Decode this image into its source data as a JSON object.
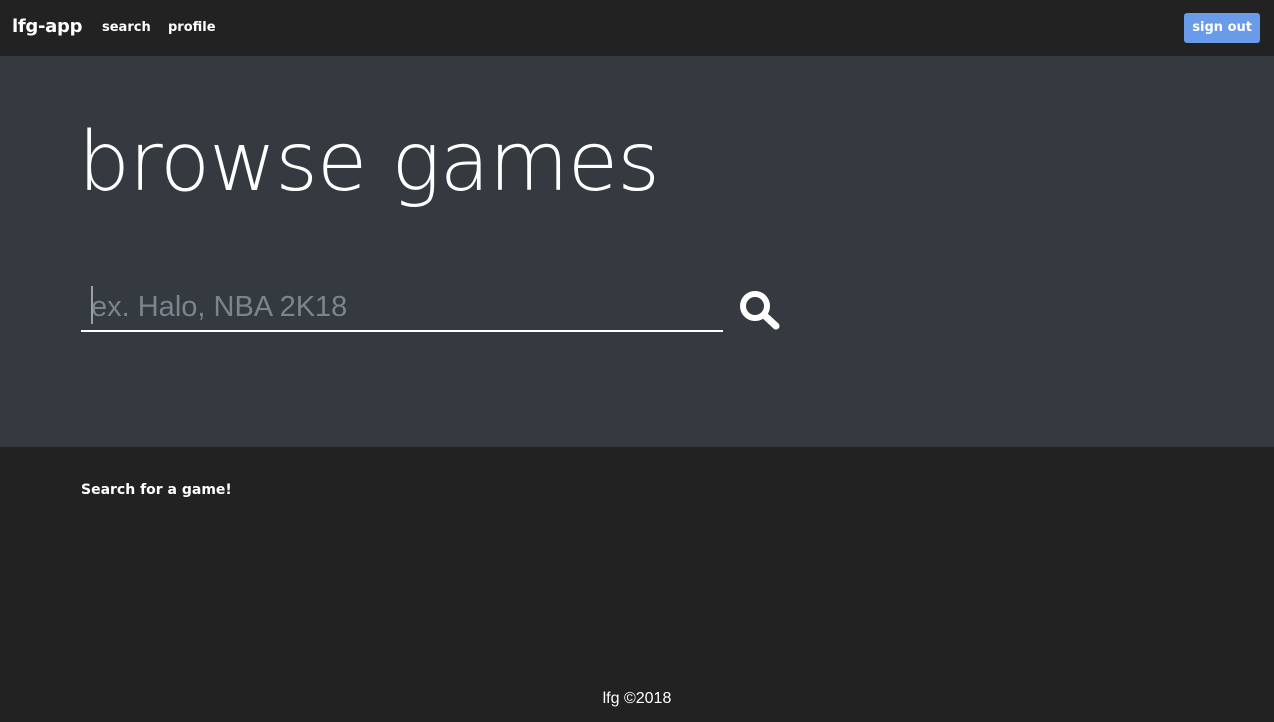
{
  "navbar": {
    "brand": "lfg-app",
    "links": [
      {
        "label": "search"
      },
      {
        "label": "profile"
      }
    ],
    "sign_out_label": "sign out",
    "sign_out_color": "#6a9be8"
  },
  "hero": {
    "title": "browse games",
    "search": {
      "placeholder": "ex. Halo, NBA 2K18",
      "value": "",
      "button_icon": "search-icon"
    },
    "background_color": "#343a40"
  },
  "results": {
    "message": "Search for a game!"
  },
  "footer": {
    "text": "lfg ©2018"
  }
}
